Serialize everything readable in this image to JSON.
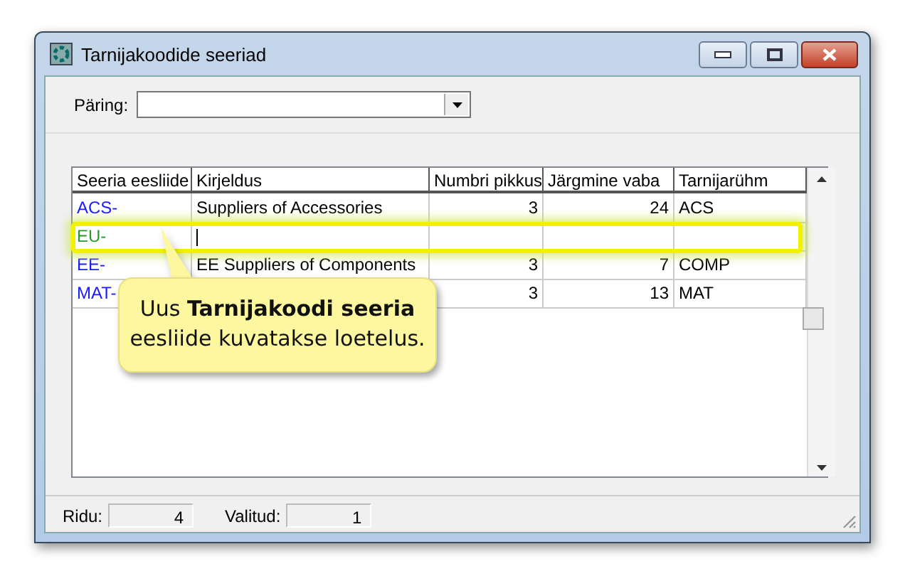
{
  "window": {
    "title": "Tarnijakoodide seeriad"
  },
  "query": {
    "label": "Päring:"
  },
  "table": {
    "columns": [
      "Seeria eesliide",
      "Kirjeldus",
      "Numbri pikkus",
      "Järgmine vaba",
      "Tarnijarühm"
    ],
    "rows": [
      {
        "new": false,
        "highlighted": false,
        "cells": [
          "ACS-",
          "Suppliers of Accessories",
          "3",
          "24",
          "ACS"
        ]
      },
      {
        "new": true,
        "highlighted": true,
        "editing": true,
        "cells": [
          "EU-",
          "",
          "",
          "",
          ""
        ]
      },
      {
        "new": false,
        "highlighted": false,
        "cells": [
          "EE-",
          "EE Suppliers of Components",
          "3",
          "7",
          "COMP"
        ]
      },
      {
        "new": false,
        "highlighted": false,
        "cells": [
          "MAT-",
          "",
          "3",
          "13",
          "MAT"
        ]
      }
    ]
  },
  "callout": {
    "text": "Uus **Tarnijakoodi  seeria** eesliide kuvatakse loetelus."
  },
  "status_bar": {
    "rows_label": "Ridu:",
    "rows_value": "4",
    "selected_label": "Valitud:",
    "selected_value": "1"
  }
}
